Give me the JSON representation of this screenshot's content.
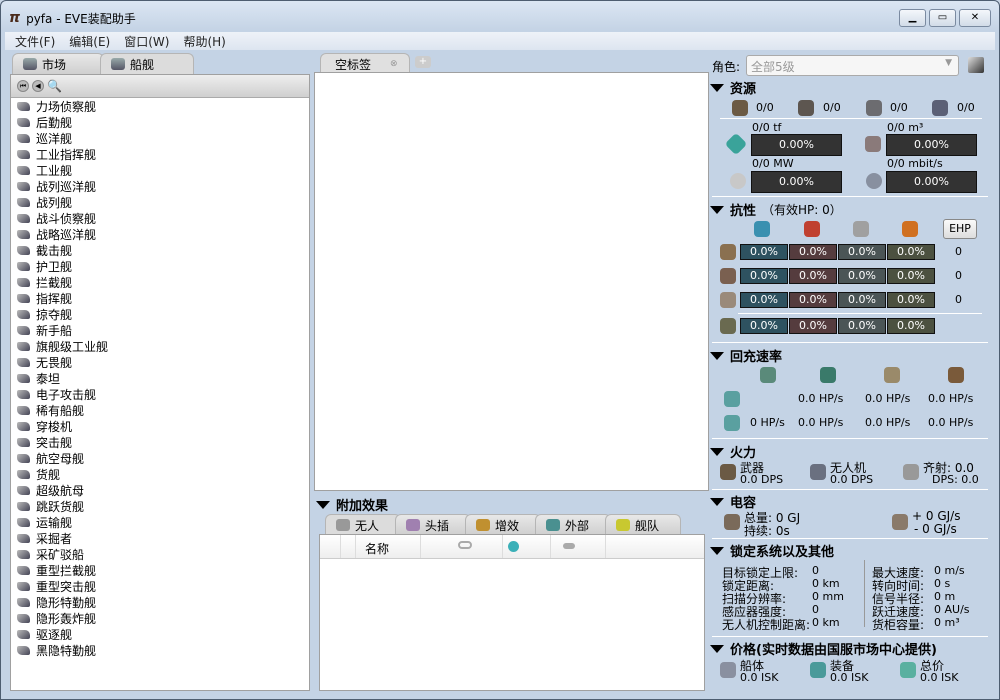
{
  "window": {
    "title": "pyfa - EVE装配助手",
    "logo": "π"
  },
  "menu": [
    "文件(F)",
    "编辑(E)",
    "窗口(W)",
    "帮助(H)"
  ],
  "left_tabs": [
    {
      "label": "市场"
    },
    {
      "label": "船舰"
    }
  ],
  "ships": [
    "力场侦察舰",
    "后勤舰",
    "巡洋舰",
    "工业指挥舰",
    "工业舰",
    "战列巡洋舰",
    "战列舰",
    "战斗侦察舰",
    "战略巡洋舰",
    "截击舰",
    "护卫舰",
    "拦截舰",
    "指挥舰",
    "掠夺舰",
    "新手船",
    "旗舰级工业舰",
    "无畏舰",
    "泰坦",
    "电子攻击舰",
    "稀有船舰",
    "穿梭机",
    "突击舰",
    "航空母舰",
    "货舰",
    "超级航母",
    "跳跃货舰",
    "运输舰",
    "采掘者",
    "采矿驳船",
    "重型拦截舰",
    "重型突击舰",
    "隐形特勤舰",
    "隐形轰炸舰",
    "驱逐舰",
    "黑隐特勤舰"
  ],
  "fit_tab": {
    "label": "空标签"
  },
  "projected": {
    "title": "附加效果",
    "tabs": [
      "无人",
      "头插",
      "增效",
      "外部",
      "舰队"
    ],
    "column_name": "名称"
  },
  "character": {
    "label": "角色:",
    "value": "全部5级"
  },
  "resources": {
    "title": "资源",
    "slots": [
      "0/0",
      "0/0",
      "0/0",
      "0/0"
    ],
    "cpu": {
      "label": "0/0 tf",
      "value": "0.00%"
    },
    "cargo": {
      "label": "0/0 m³",
      "value": "0.00%"
    },
    "power": {
      "label": "0/0 MW",
      "value": "0.00%"
    },
    "bandwidth": {
      "label": "0/0 mbit/s",
      "value": "0.00%"
    }
  },
  "resists": {
    "title": "抗性",
    "ehp_text": "（有效HP: 0）",
    "ehp_button": "EHP",
    "rows": [
      {
        "values": [
          "0.0%",
          "0.0%",
          "0.0%",
          "0.0%"
        ],
        "hp": "0"
      },
      {
        "values": [
          "0.0%",
          "0.0%",
          "0.0%",
          "0.0%"
        ],
        "hp": "0"
      },
      {
        "values": [
          "0.0%",
          "0.0%",
          "0.0%",
          "0.0%"
        ],
        "hp": "0"
      },
      {
        "values": [
          "0.0%",
          "0.0%",
          "0.0%",
          "0.0%"
        ],
        "hp": ""
      }
    ]
  },
  "recharge": {
    "title": "回充速率",
    "row1": [
      "",
      "0.0 HP/s",
      "0.0 HP/s",
      "0.0 HP/s"
    ],
    "row2": [
      "0 HP/s",
      "0.0 HP/s",
      "0.0 HP/s",
      "0.0 HP/s"
    ]
  },
  "firepower": {
    "title": "火力",
    "weapon_label": "武器",
    "weapon_dps": "0.0 DPS",
    "drone_label": "无人机",
    "drone_dps": "0.0 DPS",
    "volley": "齐射: 0.0",
    "dps": "DPS: 0.0"
  },
  "capacitor": {
    "title": "电容",
    "total": "总量: 0 GJ",
    "duration": "持续: 0s",
    "plus": "+ 0 GJ/s",
    "minus": "- 0 GJ/s"
  },
  "targeting": {
    "title": "锁定系统以及其他",
    "left": [
      [
        "目标锁定上限:",
        "0"
      ],
      [
        "锁定距离:",
        "0 km"
      ],
      [
        "扫描分辨率:",
        "0 mm"
      ],
      [
        "感应器强度:",
        "0"
      ],
      [
        "无人机控制距离:",
        "0 km"
      ]
    ],
    "right": [
      [
        "最大速度:",
        "0 m/s"
      ],
      [
        "转向时间:",
        "0 s"
      ],
      [
        "信号半径:",
        "0 m"
      ],
      [
        "跃迁速度:",
        "0 AU/s"
      ],
      [
        "货柜容量:",
        "0 m³"
      ]
    ]
  },
  "price": {
    "title": "价格(实时数据由国服市场中心提供)",
    "hull_label": "船体",
    "hull": "0.0 ISK",
    "fit_label": "装备",
    "fit": "0.0 ISK",
    "total_label": "总价",
    "total": "0.0 ISK"
  },
  "colors": {
    "em": "#2e5260",
    "thermal": "#553c3e",
    "kinetic": "#4b5556",
    "explosive": "#4c5140"
  }
}
